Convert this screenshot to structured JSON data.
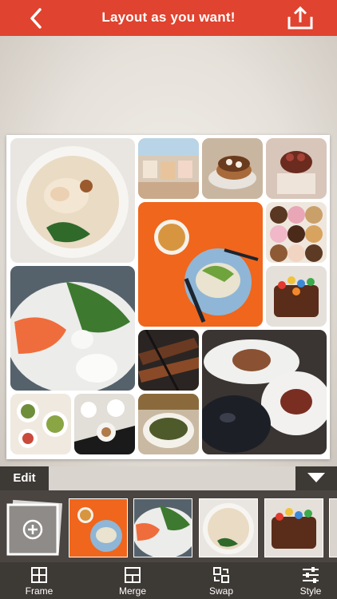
{
  "header": {
    "title": "Layout as you want!",
    "back_icon": "chevron-left-icon",
    "share_icon": "share-icon"
  },
  "editbar": {
    "edit_label": "Edit",
    "collapse_icon": "triangle-down-icon"
  },
  "strip": {
    "add_icon": "plus-circle-icon",
    "thumbs": [
      "orange chicken rice",
      "salmon salad",
      "noodle soup",
      "chocolate cake"
    ]
  },
  "tabs": [
    {
      "label": "Frame",
      "icon": "frame-grid-icon"
    },
    {
      "label": "Merge",
      "icon": "merge-icon"
    },
    {
      "label": "Swap",
      "icon": "swap-icon"
    },
    {
      "label": "Style",
      "icon": "sliders-icon"
    }
  ],
  "colors": {
    "accent": "#e0432f",
    "dark": "#3d3935",
    "strip": "#4a4541"
  }
}
